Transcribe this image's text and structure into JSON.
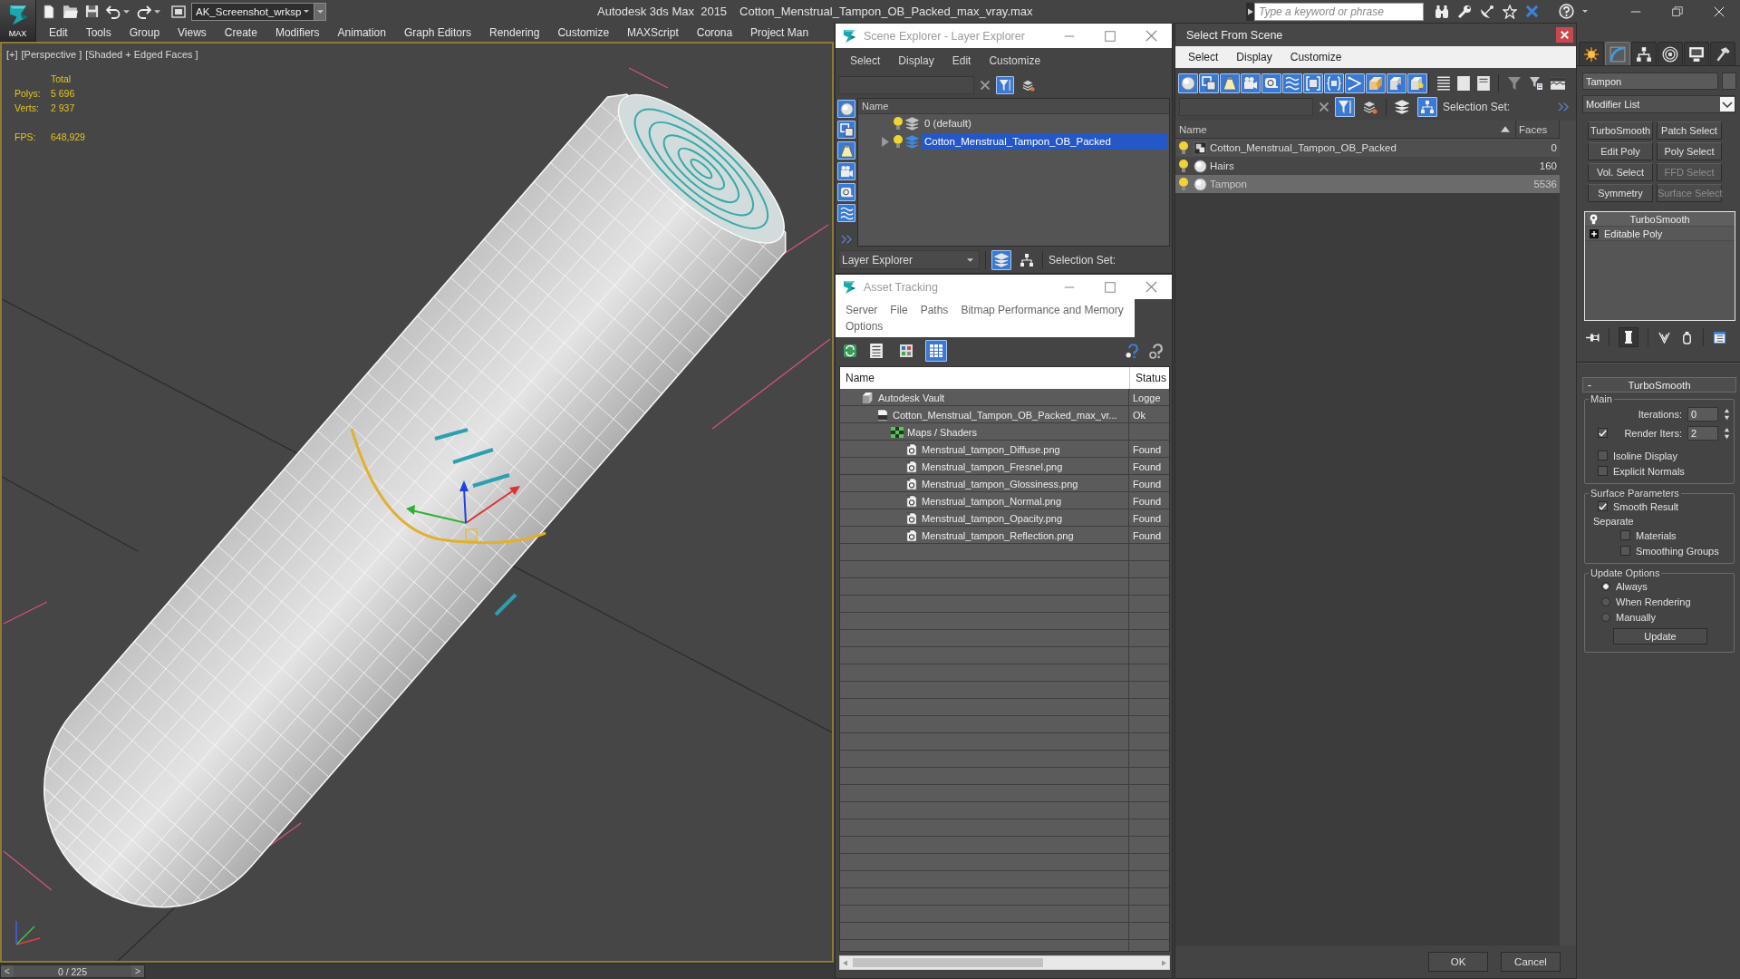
{
  "app": {
    "logo": "MAX",
    "workspace": "AK_Screenshot_wrksp",
    "product": "Autodesk 3ds Max  2015",
    "file": "Cotton_Menstrual_Tampon_OB_Packed_max_vray.max",
    "search": {
      "placeholder": "Type a keyword or phrase"
    }
  },
  "menu": [
    "Edit",
    "Tools",
    "Group",
    "Views",
    "Create",
    "Modifiers",
    "Animation",
    "Graph Editors",
    "Rendering",
    "Customize",
    "MAXScript",
    "Corona",
    "Project Man"
  ],
  "viewport": {
    "active": true,
    "labels": [
      "[+]",
      "[Perspective ]",
      "[Shaded + Edged Faces ]"
    ],
    "stats_header": "Total",
    "stats": [
      {
        "label": "Polys:",
        "value": "5 696"
      },
      {
        "label": "Verts:",
        "value": "2 937"
      }
    ],
    "fps_label": "FPS:",
    "fps": "648,929"
  },
  "timeline": {
    "prev": "<",
    "position": "0 / 225",
    "next": ">",
    "level": 0
  },
  "scene_explorer": {
    "title": "Scene Explorer - Layer Explorer",
    "menu": [
      "Select",
      "Display",
      "Edit",
      "Customize"
    ],
    "search_tools": [
      {
        "kind": "filter",
        "on": true
      },
      {
        "kind": "layer_star",
        "on": false
      }
    ],
    "filters": [
      {
        "kind": "geometry",
        "on": true
      },
      {
        "kind": "shapes",
        "on": true
      },
      {
        "kind": "lights",
        "on": true
      },
      {
        "kind": "cameras",
        "on": true
      },
      {
        "kind": "helpers",
        "on": true
      },
      {
        "kind": "space_warps",
        "on": true
      }
    ],
    "column": "Name",
    "layers": [
      {
        "name": "0 (default)",
        "expandable": false,
        "active": false,
        "selected": false
      },
      {
        "name": "Cotton_Menstrual_Tampon_OB_Packed",
        "expandable": true,
        "active": true,
        "selected": true
      }
    ],
    "mode": "Layer Explorer",
    "view_modes": [
      {
        "kind": "layers",
        "on": true
      },
      {
        "kind": "hierarchy",
        "on": false
      }
    ],
    "selection_set_label": "Selection Set:"
  },
  "asset_tracking": {
    "title": "Asset Tracking",
    "menu": [
      "Server",
      "File",
      "Paths",
      "Bitmap Performance and Memory",
      "Options"
    ],
    "views": [
      {
        "kind": "list",
        "on": false
      },
      {
        "kind": "thumbnails",
        "on": false
      },
      {
        "kind": "table",
        "on": true
      }
    ],
    "columns": [
      "Name",
      "Status"
    ],
    "items": [
      {
        "kind": "vault",
        "name": "Autodesk Vault",
        "status": "Logge",
        "children": [
          {
            "kind": "max_file",
            "name": "Cotton_Menstrual_Tampon_OB_Packed_max_vr...",
            "status": "Ok",
            "children": [
              {
                "kind": "maps",
                "name": "Maps / Shaders",
                "children": [
                  {
                    "kind": "bitmap",
                    "name": "Menstrual_tampon_Diffuse.png",
                    "status": "Found"
                  },
                  {
                    "kind": "bitmap",
                    "name": "Menstrual_tampon_Fresnel.png",
                    "status": "Found"
                  },
                  {
                    "kind": "bitmap",
                    "name": "Menstrual_tampon_Glossiness.png",
                    "status": "Found"
                  },
                  {
                    "kind": "bitmap",
                    "name": "Menstrual_tampon_Normal.png",
                    "status": "Found"
                  },
                  {
                    "kind": "bitmap",
                    "name": "Menstrual_tampon_Opacity.png",
                    "status": "Found"
                  },
                  {
                    "kind": "bitmap",
                    "name": "Menstrual_tampon_Reflection.png",
                    "status": "Found"
                  }
                ]
              }
            ]
          }
        ]
      }
    ]
  },
  "select_from_scene": {
    "title": "Select From Scene",
    "menu": [
      "Select",
      "Display",
      "Customize"
    ],
    "filters": [
      {
        "kind": "geometry",
        "on": true
      },
      {
        "kind": "shapes",
        "on": true
      },
      {
        "kind": "lights",
        "on": true
      },
      {
        "kind": "cameras",
        "on": true
      },
      {
        "kind": "helpers",
        "on": true
      },
      {
        "kind": "space_warps",
        "on": true
      },
      {
        "kind": "groups",
        "on": true
      },
      {
        "kind": "xrefs",
        "on": true
      },
      {
        "kind": "bones",
        "on": true
      },
      {
        "kind": "containers",
        "on": true
      },
      {
        "kind": "frozen",
        "on": true
      },
      {
        "kind": "hidden",
        "on": true
      }
    ],
    "search_tools": [
      {
        "kind": "filter",
        "on": true
      },
      {
        "kind": "layer_star",
        "on": false
      }
    ],
    "view_modes": [
      {
        "kind": "layers",
        "on": false
      },
      {
        "kind": "hierarchy",
        "on": true
      }
    ],
    "selection_set_label": "Selection Set:",
    "columns": [
      "Name",
      "Faces"
    ],
    "sort_ascending": true,
    "rows": [
      {
        "kind": "group",
        "name": "Cotton_Menstrual_Tampon_OB_Packed",
        "faces": "0",
        "selected": false
      },
      {
        "kind": "geometry",
        "name": "Hairs",
        "faces": "160",
        "selected": false
      },
      {
        "kind": "geometry",
        "name": "Tampon",
        "faces": "5536",
        "selected": true
      }
    ],
    "buttons": [
      "OK",
      "Cancel"
    ]
  },
  "command_panel": {
    "tabs": [
      {
        "kind": "create",
        "selected": false
      },
      {
        "kind": "modify",
        "selected": true
      },
      {
        "kind": "hierarchy",
        "selected": false
      },
      {
        "kind": "motion",
        "selected": false
      },
      {
        "kind": "display",
        "selected": false
      },
      {
        "kind": "utilities",
        "selected": false
      }
    ],
    "object_name": "Tampon",
    "modifier_list": "Modifier List",
    "modifier_buttons": [
      {
        "label": "TurboSmooth",
        "disabled": false
      },
      {
        "label": "Patch Select",
        "disabled": false
      },
      {
        "label": "Edit Poly",
        "disabled": false
      },
      {
        "label": "Poly Select",
        "disabled": false
      },
      {
        "label": "Vol. Select",
        "disabled": false
      },
      {
        "label": "FFD Select",
        "disabled": true
      },
      {
        "label": "Symmetry",
        "disabled": false
      },
      {
        "label": "Surface Select",
        "disabled": true
      }
    ],
    "stack": [
      {
        "kind": "modifier",
        "name": "TurboSmooth"
      },
      {
        "kind": "base",
        "name": "Editable Poly"
      }
    ],
    "stack_tools": [
      {
        "kind": "pin",
        "on": false
      },
      {
        "kind": "end_result",
        "on": true
      },
      {
        "kind": "unique",
        "on": false
      },
      {
        "kind": "remove",
        "on": false
      },
      {
        "kind": "configure",
        "on": false
      }
    ],
    "rollout": {
      "collapse": "-",
      "title": "TurboSmooth",
      "groups": [
        {
          "label": "Main",
          "items": [
            {
              "kind": "spinner",
              "label": "Iterations:",
              "value": "0"
            },
            {
              "kind": "checked_spinner",
              "label": "Render Iters:",
              "value": "2",
              "checked": true
            },
            {
              "kind": "checkbox",
              "label": "Isoline Display",
              "checked": false
            },
            {
              "kind": "checkbox",
              "label": "Explicit Normals",
              "checked": false
            }
          ]
        },
        {
          "label": "Surface Parameters",
          "items": [
            {
              "kind": "checkbox",
              "label": "Smooth Result",
              "checked": true
            },
            {
              "kind": "text",
              "label": "Separate"
            },
            {
              "kind": "sub_checkbox",
              "label": "Materials",
              "checked": false
            },
            {
              "kind": "sub_checkbox",
              "label": "Smoothing Groups",
              "checked": false
            }
          ]
        },
        {
          "label": "Update Options",
          "items": [
            {
              "kind": "radio",
              "label": "Always",
              "selected": true
            },
            {
              "kind": "radio",
              "label": "When Rendering",
              "selected": false
            },
            {
              "kind": "radio",
              "label": "Manually",
              "selected": false
            },
            {
              "kind": "button",
              "label": "Update"
            }
          ]
        }
      ]
    }
  }
}
